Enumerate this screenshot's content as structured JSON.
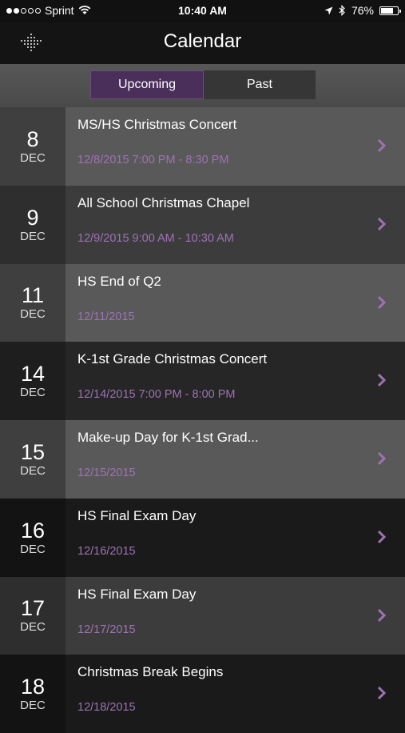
{
  "status_bar": {
    "carrier": "Sprint",
    "time": "10:40 AM",
    "battery_text": "76%",
    "battery_level": 0.76,
    "signal_bars_filled": 2,
    "signal_bars_total": 5
  },
  "nav": {
    "title": "Calendar",
    "menu_icon": "menu-dots-icon"
  },
  "segment": {
    "upcoming_label": "Upcoming",
    "past_label": "Past",
    "selected": "Upcoming"
  },
  "colors": {
    "accent_purple": "#9d72b4",
    "segment_active": "#4a2f5b"
  },
  "events": [
    {
      "day": "8",
      "month": "DEC",
      "title": "MS/HS Christmas Concert",
      "time": "12/8/2015 7:00 PM - 8:30 PM"
    },
    {
      "day": "9",
      "month": "DEC",
      "title": "All School Christmas Chapel",
      "time": "12/9/2015 9:00 AM - 10:30 AM"
    },
    {
      "day": "11",
      "month": "DEC",
      "title": "HS End of Q2",
      "time": "12/11/2015"
    },
    {
      "day": "14",
      "month": "DEC",
      "title": "K-1st Grade Christmas Concert",
      "time": "12/14/2015 7:00 PM - 8:00 PM"
    },
    {
      "day": "15",
      "month": "DEC",
      "title": "Make-up Day for K-1st Grad...",
      "time": "12/15/2015"
    },
    {
      "day": "16",
      "month": "DEC",
      "title": "HS Final Exam Day",
      "time": "12/16/2015"
    },
    {
      "day": "17",
      "month": "DEC",
      "title": "HS Final Exam Day",
      "time": "12/17/2015"
    },
    {
      "day": "18",
      "month": "DEC",
      "title": "Christmas Break Begins",
      "time": "12/18/2015"
    }
  ]
}
